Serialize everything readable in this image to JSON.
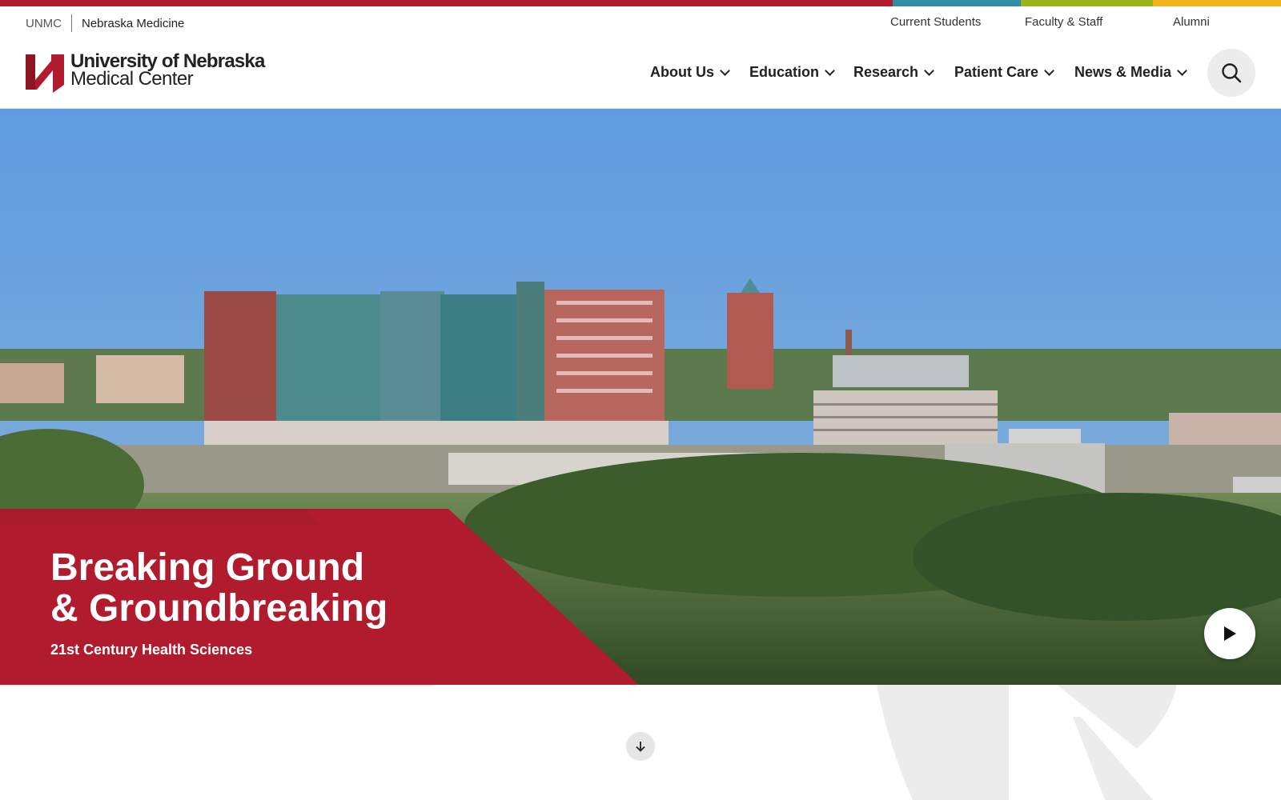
{
  "utility": {
    "unmc": "UNMC",
    "nebraska_medicine": "Nebraska Medicine",
    "links": [
      "Current Students",
      "Faculty & Staff",
      "Alumni"
    ]
  },
  "logo": {
    "line1": "University of Nebraska",
    "line2": "Medical Center"
  },
  "nav": [
    {
      "label": "About Us"
    },
    {
      "label": "Education"
    },
    {
      "label": "Research"
    },
    {
      "label": "Patient Care"
    },
    {
      "label": "News & Media"
    }
  ],
  "hero": {
    "title_line1": "Breaking Ground",
    "title_line2": "& Groundbreaking",
    "subtitle": "21st Century Health Sciences"
  },
  "icons": {
    "search": "search-icon",
    "play": "play-icon",
    "scroll": "arrow-down-icon",
    "logo": "unmc-n-logo"
  },
  "colors": {
    "brand_red": "#b01c2e",
    "teal": "#2f8fa6",
    "green": "#9bb21c",
    "gold": "#f2b21b"
  }
}
